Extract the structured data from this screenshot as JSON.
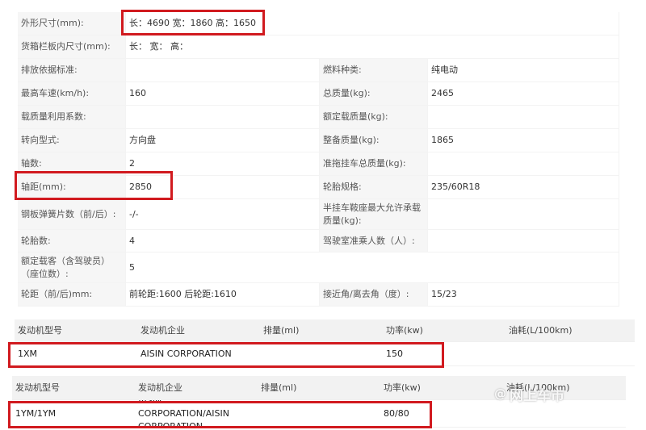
{
  "specs": {
    "rows": [
      [
        {
          "label": "外形尺寸(mm):",
          "value": "长：4690 宽：1860 高：1650"
        }
      ],
      [
        {
          "label": "货箱栏板内尺寸(mm):",
          "value": "长：  宽：  高："
        }
      ],
      [
        {
          "label": "排放依据标准:",
          "value": ""
        },
        {
          "label": "燃料种类:",
          "value": "纯电动"
        }
      ],
      [
        {
          "label": "最高车速(km/h):",
          "value": "160"
        },
        {
          "label": "总质量(kg):",
          "value": "2465"
        }
      ],
      [
        {
          "label": "载质量利用系数:",
          "value": ""
        },
        {
          "label": "额定载质量(kg):",
          "value": ""
        }
      ],
      [
        {
          "label": "转向型式:",
          "value": "方向盘"
        },
        {
          "label": "整备质量(kg):",
          "value": "1865"
        }
      ],
      [
        {
          "label": "轴数:",
          "value": "2"
        },
        {
          "label": "准拖挂车总质量(kg):",
          "value": ""
        }
      ],
      [
        {
          "label": "轴距(mm):",
          "value": "2850"
        },
        {
          "label": "轮胎规格:",
          "value": "235/60R18"
        }
      ],
      [
        {
          "label": "钢板弹簧片数（前/后）:",
          "value": "-/-"
        },
        {
          "label": "半挂车鞍座最大允许承载质量(kg):",
          "value": ""
        }
      ],
      [
        {
          "label": "轮胎数:",
          "value": "4"
        },
        {
          "label": "驾驶室准乘人数（人）:",
          "value": ""
        }
      ],
      [
        {
          "label": "额定载客（含驾驶员）（座位数）:",
          "value": "5"
        }
      ],
      [
        {
          "label": "轮距（前/后)mm:",
          "value": "前轮距:1600 后轮距:1610"
        },
        {
          "label": "接近角/离去角（度）:",
          "value": "15/23"
        }
      ]
    ]
  },
  "engine_tables": [
    {
      "headers": [
        "发动机型号",
        "发动机企业",
        "排量(ml)",
        "功率(kw)",
        "油耗(L/100km)"
      ],
      "row": [
        "1XM",
        "AISIN CORPORATION",
        "",
        "150",
        ""
      ]
    },
    {
      "headers": [
        "发动机型号",
        "发动机企业",
        "排量(ml)",
        "功率(kw)",
        "油耗(L/100km)"
      ],
      "row": [
        "1YM/1YM",
        "AISIN CORPORATION/AISIN CORPORATION",
        "",
        "80/80",
        ""
      ]
    }
  ],
  "watermark": {
    "at": "@",
    "text": "网上车市"
  },
  "colors": {
    "highlight": "#d11a1f",
    "label_bg": "#f6f6f6",
    "header_bg": "#f2f2f2"
  }
}
